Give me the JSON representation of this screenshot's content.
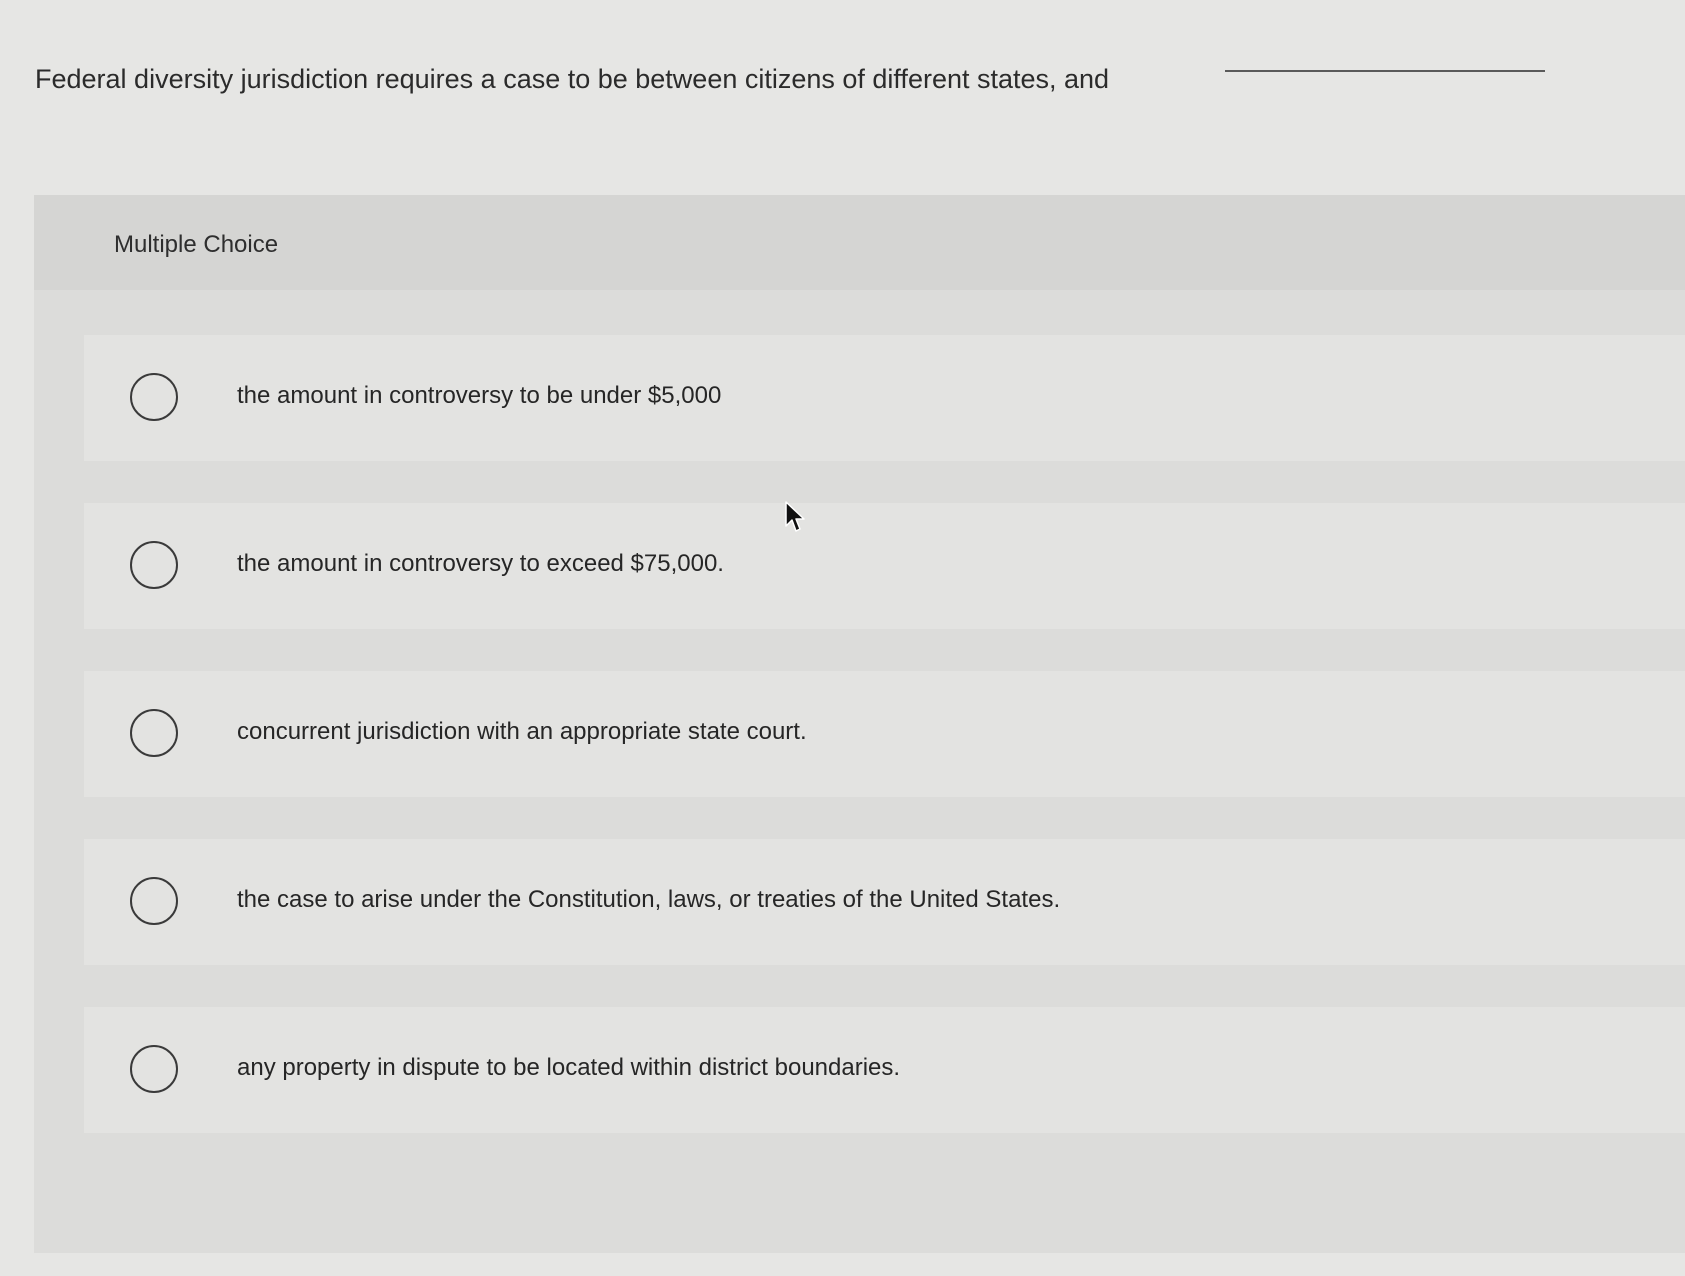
{
  "question": {
    "text": "Federal diversity jurisdiction requires a case to be between citizens of different states, and"
  },
  "panel": {
    "title": "Multiple Choice"
  },
  "options": [
    {
      "label": "the amount in controversy to be under $5,000",
      "selected": false
    },
    {
      "label": "the amount in controversy to exceed $75,000.",
      "selected": false
    },
    {
      "label": "concurrent jurisdiction with an appropriate state court.",
      "selected": false
    },
    {
      "label": "the case to arise under the Constitution, laws, or treaties of the United States.",
      "selected": false
    },
    {
      "label": "any property in dispute to be located within district boundaries.",
      "selected": false
    }
  ],
  "icons": {
    "cursor": "mouse-pointer-icon",
    "radio": "radio-unchecked-icon"
  }
}
